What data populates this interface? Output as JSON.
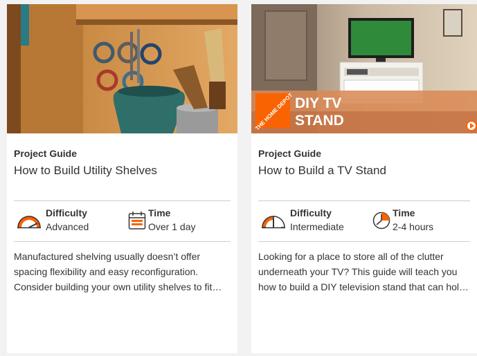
{
  "cards": [
    {
      "eyebrow": "Project Guide",
      "title": "How to Build Utility Shelves",
      "difficulty_label": "Difficulty",
      "difficulty_value": "Advanced",
      "time_label": "Time",
      "time_value": "Over 1 day",
      "desc_lines": [
        "Manufactured shelving usually doesn’t offer",
        "spacing flexibility and easy reconfiguration.",
        "Consider building your own utility shelves to fit…"
      ]
    },
    {
      "eyebrow": "Project Guide",
      "title": "How to Build a TV Stand",
      "difficulty_label": "Difficulty",
      "difficulty_value": "Intermediate",
      "time_label": "Time",
      "time_value": "2-4 hours",
      "desc_lines": [
        "Looking for a place to store all of the clutter",
        "underneath your TV? This guide will teach you",
        "how to build a DIY television stand that can hol…"
      ],
      "banner_brand": "THE HOME DEPOT",
      "banner_line1": "DIY TV",
      "banner_line2": "STAND"
    }
  ],
  "colors": {
    "accent": "#f96302",
    "border": "#cccccc",
    "text": "#333333"
  },
  "icons": {
    "difficulty": "gauge-icon",
    "time_calendar": "calendar-icon",
    "time_clock": "clock-icon",
    "play": "play-icon"
  }
}
